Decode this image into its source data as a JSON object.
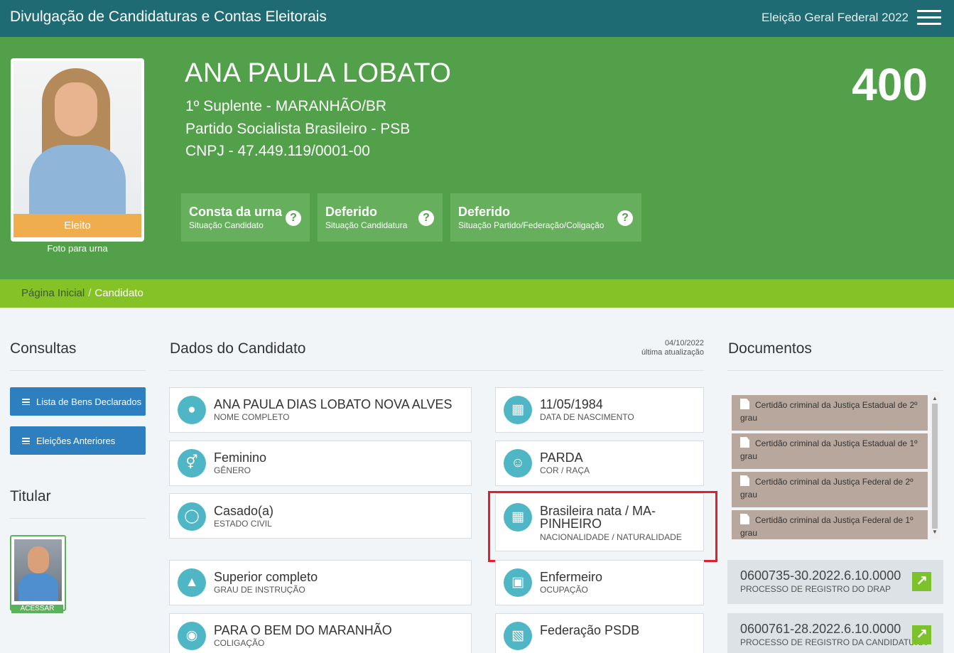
{
  "header": {
    "title": "Divulgação de Candidaturas e Contas Eleitorais",
    "election": "Eleição Geral Federal 2022"
  },
  "candidate": {
    "name": "ANA PAULA LOBATO",
    "position": "1º Suplente - MARANHÃO/BR",
    "party": "Partido Socialista Brasileiro - PSB",
    "cnpj": "CNPJ - 47.449.119/0001-00",
    "number": "400",
    "badge": "Eleito",
    "photo_caption": "Foto para urna",
    "statuses": [
      {
        "title": "Consta da urna",
        "subtitle": "Situação Candidato"
      },
      {
        "title": "Deferido",
        "subtitle": "Situação Candidatura"
      },
      {
        "title": "Deferido",
        "subtitle": "Situação Partido/Federação/Coligação"
      }
    ],
    "help_glyph": "?"
  },
  "breadcrumb": {
    "home": "Página Inicial",
    "separator": "/",
    "current": "Candidato"
  },
  "consultas": {
    "title": "Consultas",
    "buttons": [
      "Lista de Bens Declarados",
      "Eleições Anteriores"
    ]
  },
  "titular": {
    "title": "Titular",
    "button": "ACESSAR"
  },
  "dados": {
    "title": "Dados do Candidato",
    "updated_date": "04/10/2022",
    "updated_label": "última atualização",
    "fields": [
      {
        "value": "ANA PAULA DIAS LOBATO NOVA ALVES",
        "label": "NOME COMPLETO",
        "icon": "user-icon"
      },
      {
        "value": "11/05/1984",
        "label": "DATA DE NASCIMENTO",
        "icon": "calendar-icon"
      },
      {
        "value": "Feminino",
        "label": "GÊNERO",
        "icon": "gender-icon"
      },
      {
        "value": "PARDA",
        "label": "COR / RAÇA",
        "icon": "person-icon"
      },
      {
        "value": "Casado(a)",
        "label": "ESTADO CIVIL",
        "icon": "ring-icon"
      },
      {
        "value": "Brasileira nata / MA-PINHEIRO",
        "label": "NACIONALIDADE / NATURALIDADE",
        "icon": "map-icon"
      },
      {
        "value": "Superior completo",
        "label": "GRAU DE INSTRUÇÃO",
        "icon": "graduation-cap-icon"
      },
      {
        "value": "Enfermeiro",
        "label": "OCUPAÇÃO",
        "icon": "institution-icon"
      },
      {
        "value": "PARA O BEM DO MARANHÃO",
        "label": "COLIGAÇÃO",
        "icon": "group-icon"
      },
      {
        "value": "Federação PSDB",
        "label": "",
        "icon": "folder-icon"
      }
    ]
  },
  "documentos": {
    "title": "Documentos",
    "items": [
      "Certidão criminal da Justiça Estadual de 2º grau",
      "Certidão criminal da Justiça Estadual de 1º grau",
      "Certidão criminal da Justiça Federal de 2º grau",
      "Certidão criminal da Justiça Federal de 1º grau"
    ],
    "processos": [
      {
        "number": "0600735-30.2022.6.10.0000",
        "label": "PROCESSO DE REGISTRO DO DRAP"
      },
      {
        "number": "0600761-28.2022.6.10.0000",
        "label": "PROCESSO DE REGISTRO DA CANDIDATURA"
      }
    ]
  },
  "colors": {
    "topbar": "#1e6b73",
    "hero": "#52a04a",
    "breadcrumb": "#84c225",
    "button_blue": "#2e7fc0",
    "icon_teal": "#4fb6c5",
    "highlight_red": "#e0202a"
  }
}
